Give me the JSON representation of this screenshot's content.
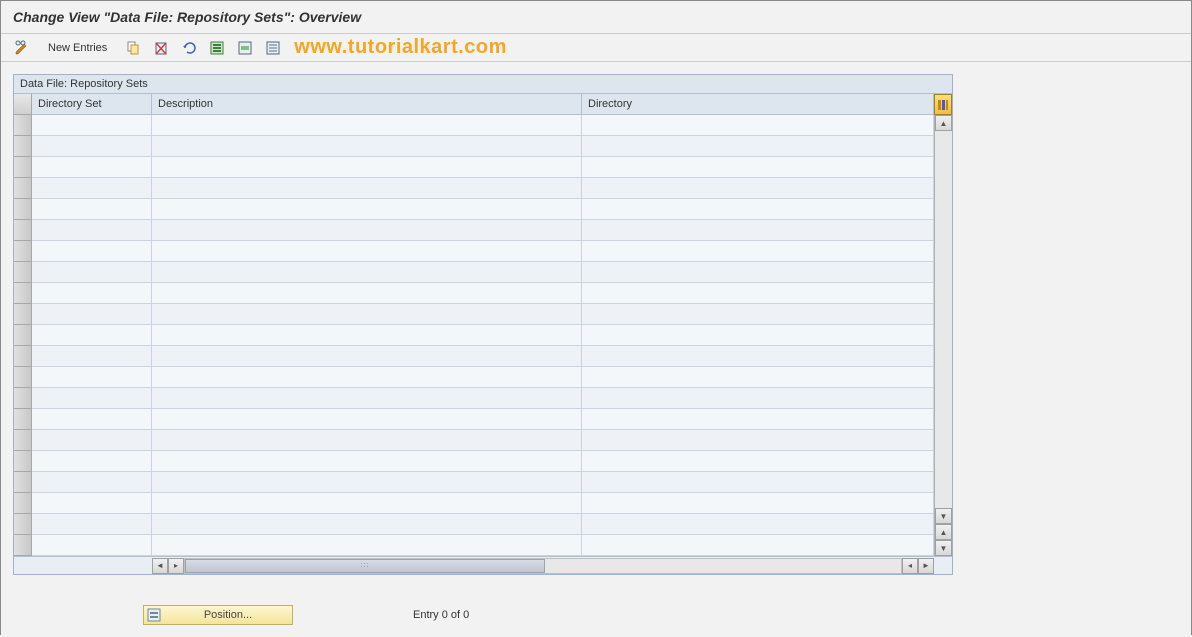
{
  "title": "Change View \"Data File: Repository Sets\": Overview",
  "toolbar": {
    "new_entries_label": "New Entries"
  },
  "watermark": "www.tutorialkart.com",
  "table": {
    "title": "Data File: Repository Sets",
    "columns": {
      "directory_set": "Directory Set",
      "description": "Description",
      "directory": "Directory"
    },
    "row_count": 21
  },
  "footer": {
    "position_label": "Position...",
    "entry_text": "Entry 0 of 0"
  }
}
